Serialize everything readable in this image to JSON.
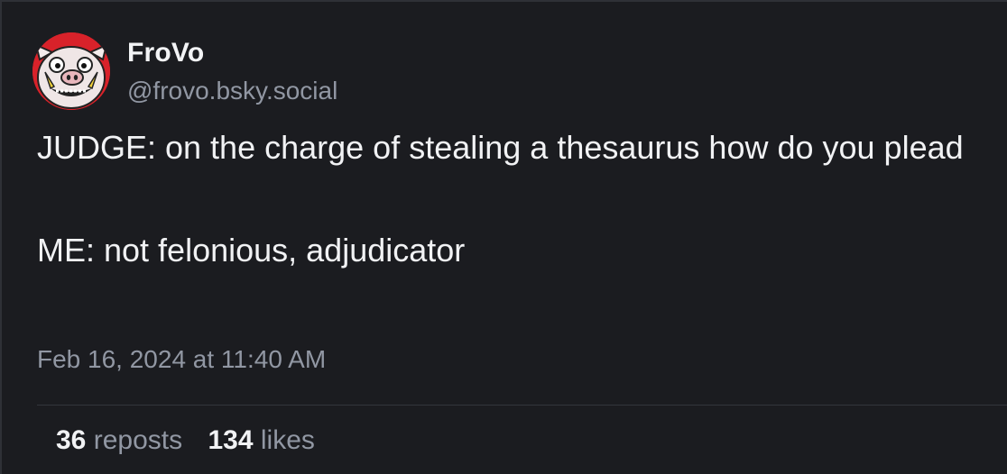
{
  "author": {
    "display_name": "FroVo",
    "handle": "@frovo.bsky.social",
    "avatar": "pig-face-avatar"
  },
  "post": {
    "lines": [
      "JUDGE: on the charge of stealing a thesaurus how do you plead",
      "ME: not felonious, adjudicator"
    ],
    "timestamp": "Feb 16, 2024 at 11:40 AM"
  },
  "stats": {
    "reposts_count": "36",
    "reposts_label": "reposts",
    "likes_count": "134",
    "likes_label": "likes"
  },
  "colors": {
    "background": "#1b1c20",
    "text": "#f1f2f4",
    "muted": "#9197a3",
    "avatar_bg": "#d8222a"
  }
}
